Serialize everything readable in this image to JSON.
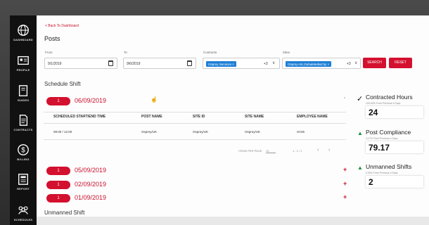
{
  "sidebar": {
    "items": [
      {
        "label": "DASHBOARD",
        "icon": "globe-icon"
      },
      {
        "label": "PROFILE",
        "icon": "id-card-icon"
      },
      {
        "label": "GUIDES",
        "icon": "book-icon"
      },
      {
        "label": "CONTRACTS",
        "icon": "document-icon"
      },
      {
        "label": "BILLING",
        "icon": "dollar-icon"
      },
      {
        "label": "REPORT",
        "icon": "report-icon"
      },
      {
        "label": "SCHEDULES",
        "icon": "people-icon"
      }
    ]
  },
  "header": {
    "back_link": "< Back To Dashboard",
    "title": "Posts"
  },
  "filters": {
    "from_label": "From",
    "from_value": "9/1/2019",
    "to_label": "To",
    "to_value": "9/6/2019",
    "contracts_label": "Contracts",
    "contracts_tag": "Osprey Services",
    "contracts_more": "+3",
    "sites_label": "Sites",
    "sites_tag": "Osprey-UK,DubaiMediaCity",
    "sites_more": "+3",
    "search_label": "SEARCH",
    "reset_label": "RESET"
  },
  "schedule": {
    "section_title": "Schedule Shift",
    "groups": [
      {
        "count": "1",
        "date": "06/09/2019"
      },
      {
        "count": "1",
        "date": "05/09/2019"
      },
      {
        "count": "1",
        "date": "02/09/2019"
      },
      {
        "count": "1",
        "date": "01/09/2019"
      }
    ],
    "columns": [
      "SCHEDULED START/END TIME",
      "POST NAME",
      "SITE ID",
      "SITE NAME",
      "EMPLOYEE NAME"
    ],
    "rows": [
      [
        "08:00 / 12:00",
        "Osprey/UK",
        "Osprey/UK",
        "Osprey/UK",
        "SV25"
      ]
    ],
    "pagination": {
      "items_per_page_label": "ITEMS PER PAGE",
      "items_per_page_value": "10",
      "range": "1 - 1 / 1"
    },
    "unmanned_title": "Unmanned Shift"
  },
  "kpis": [
    {
      "title": "Contracted Hours",
      "sub": "100.00% From Previous 4 Days",
      "value": "24",
      "icon": "check-icon"
    },
    {
      "title": "Post Compliance",
      "sub": "4.17% From Previous 4 Days",
      "value": "79.17",
      "icon": "up-triangle-icon"
    },
    {
      "title": "Unmanned Shifts",
      "sub": "0.00% From Previous 4 Days",
      "value": "2",
      "icon": "up-triangle-icon"
    }
  ],
  "colors": {
    "accent": "#d4102f",
    "tag": "#1f7fd6",
    "sidebar": "#111111",
    "trend_up": "#1a8f3a"
  }
}
